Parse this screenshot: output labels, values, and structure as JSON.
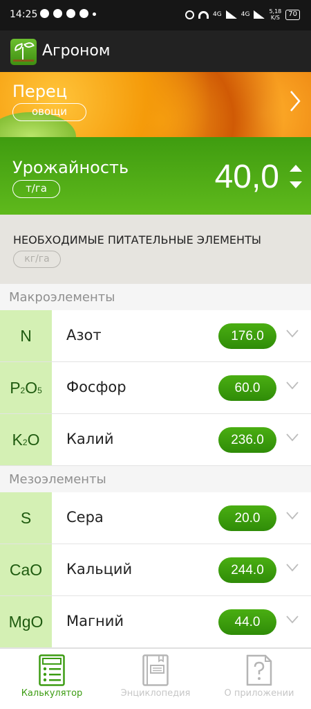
{
  "status_bar": {
    "time": "14:25",
    "network_left": "4G",
    "network_right": "4G",
    "speed_value": "5,18",
    "speed_unit": "K/S",
    "battery": "70"
  },
  "app": {
    "title": "Агроном"
  },
  "crop": {
    "name": "Перец",
    "category": "овощи"
  },
  "yield": {
    "label": "Урожайность",
    "unit": "т/га",
    "value": "40,0"
  },
  "nutrients": {
    "title": "НЕОБХОДИМЫЕ ПИТАТЕЛЬНЫЕ ЭЛЕМЕНТЫ",
    "unit": "кг/га"
  },
  "sections": [
    {
      "title": "Макроэлементы",
      "items": [
        {
          "symbol": "N",
          "name": "Азот",
          "value": "176.0"
        },
        {
          "symbol_main": "P",
          "symbol_sub1": "2",
          "symbol_mid": "O",
          "symbol_sub2": "5",
          "name": "Фосфор",
          "value": "60.0"
        },
        {
          "symbol_main": "K",
          "symbol_sub1": "2",
          "symbol_mid": "O",
          "name": "Калий",
          "value": "236.0"
        }
      ]
    },
    {
      "title": "Мезоэлементы",
      "items": [
        {
          "symbol": "S",
          "name": "Сера",
          "value": "20.0"
        },
        {
          "symbol": "CaO",
          "name": "Кальций",
          "value": "244.0"
        },
        {
          "symbol": "MgO",
          "name": "Магний",
          "value": "44.0"
        }
      ]
    }
  ],
  "bottom_nav": [
    {
      "label": "Калькулятор",
      "icon": "calculator-icon",
      "active": true
    },
    {
      "label": "Энциклопедия",
      "icon": "book-icon",
      "active": false
    },
    {
      "label": "О приложении",
      "icon": "help-icon",
      "active": false
    }
  ],
  "colors": {
    "primary_green": "#3f9c10",
    "symbol_bg": "#d4f0b4",
    "app_bar": "#222222"
  }
}
